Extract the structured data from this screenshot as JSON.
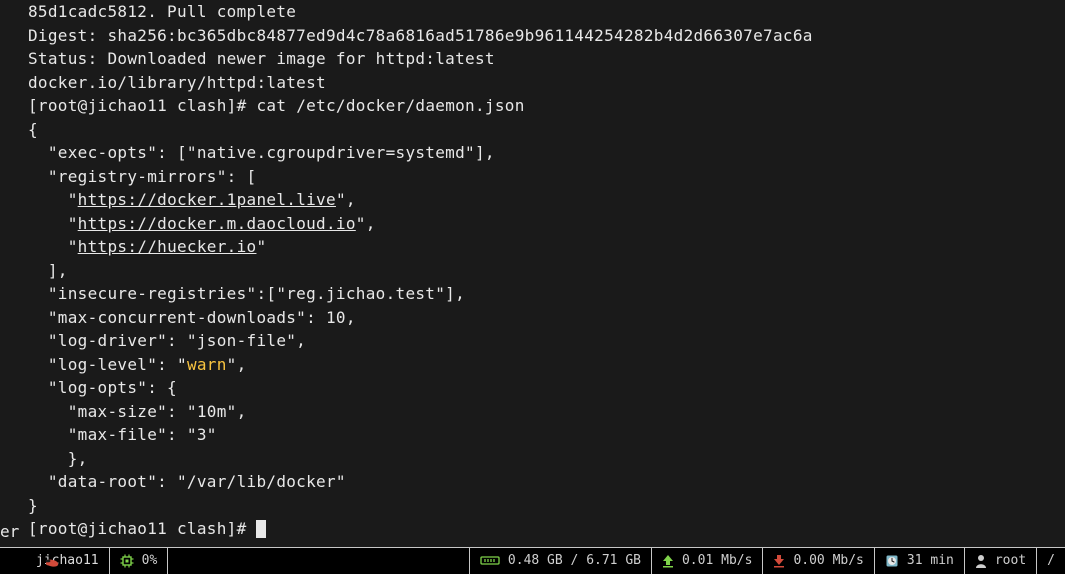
{
  "left_edge_label": "er",
  "terminal": {
    "pull_line1": "85d1cadc5812. Pull complete",
    "digest_line": "Digest: sha256:bc365dbc84877ed9d4c78a6816ad51786e9b961144254282b4d2d66307e7ac6a",
    "status_line": "Status: Downloaded newer image for httpd:latest",
    "image_ref_line": "docker.io/library/httpd:latest",
    "prompt1": "[root@jichao11 clash]# ",
    "cmd1": "cat /etc/docker/daemon.json",
    "json_open": "{",
    "exec_opts": "  \"exec-opts\": [\"native.cgroupdriver=systemd\"],",
    "registry_mirrors_open": "  \"registry-mirrors\": [",
    "mirror1_prefix": "    \"",
    "mirror1_url": "https://docker.1panel.live",
    "mirror1_suffix": "\",",
    "mirror2_prefix": "    \"",
    "mirror2_url": "https://docker.m.daocloud.io",
    "mirror2_suffix": "\",",
    "mirror3_prefix": "    \"",
    "mirror3_url": "https://huecker.io",
    "mirror3_suffix": "\"",
    "registry_mirrors_close": "  ],",
    "insecure_registries": "  \"insecure-registries\":[\"reg.jichao.test\"],",
    "max_concurrent": "  \"max-concurrent-downloads\": 10,",
    "log_driver": "  \"log-driver\": \"json-file\",",
    "log_level_prefix": "  \"log-level\": \"",
    "log_level_value": "warn",
    "log_level_suffix": "\",",
    "log_opts_open": "  \"log-opts\": {",
    "log_opts_maxsize": "    \"max-size\": \"10m\",",
    "log_opts_maxfile": "    \"max-file\": \"3\"",
    "log_opts_close": "    },",
    "data_root": "  \"data-root\": \"/var/lib/docker\"",
    "json_close": "}",
    "prompt2": "[root@jichao11 clash]# "
  },
  "statusbar": {
    "hostname": "jichao11",
    "cpu_pct": "0%",
    "mem": "0.48 GB / 6.71 GB",
    "net_up": "0.01 Mb/s",
    "net_down": "0.00 Mb/s",
    "uptime": "31 min",
    "user": "root",
    "path_fragment": "/"
  }
}
